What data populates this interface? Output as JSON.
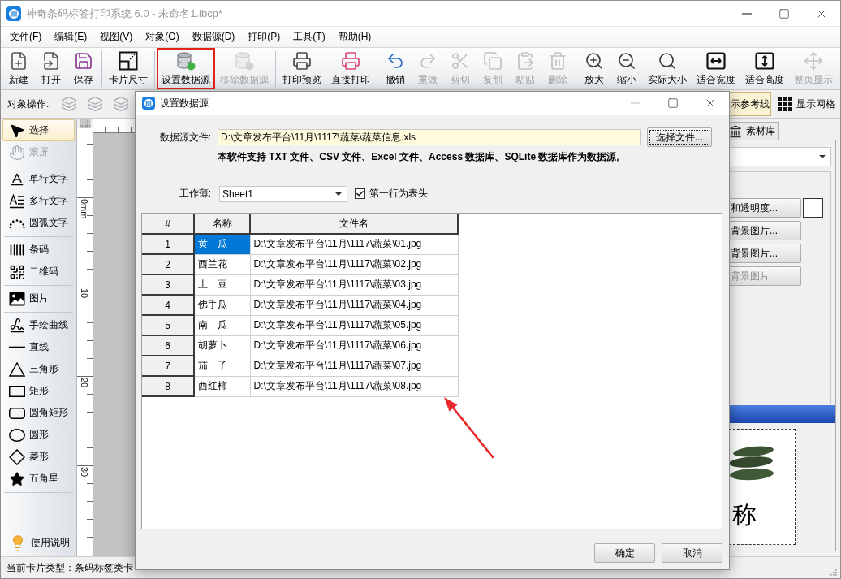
{
  "window": {
    "title": "神奇条码标签打印系统 6.0 - 未命名1.lbcp*",
    "controls": [
      {
        "kind": "minimize"
      },
      {
        "kind": "maximize"
      },
      {
        "kind": "close"
      }
    ]
  },
  "menu": [
    "文件(F)",
    "编辑(E)",
    "视图(V)",
    "对象(O)",
    "数据源(D)",
    "打印(P)",
    "工具(T)",
    "帮助(H)"
  ],
  "toolbar": [
    [
      {
        "label": "新建",
        "disabled": false,
        "highlighted": false
      },
      {
        "label": "打开",
        "disabled": false,
        "highlighted": false
      },
      {
        "label": "保存",
        "disabled": false,
        "highlighted": false
      }
    ],
    [
      {
        "label": "卡片尺寸",
        "disabled": false,
        "highlighted": false
      }
    ],
    [
      {
        "label": "设置数据源",
        "disabled": false,
        "highlighted": true
      },
      {
        "label": "移除数据源",
        "disabled": true,
        "highlighted": false
      }
    ],
    [
      {
        "label": "打印预览",
        "disabled": false,
        "highlighted": false
      },
      {
        "label": "直接打印",
        "disabled": false,
        "highlighted": false
      }
    ],
    [
      {
        "label": "撤销",
        "disabled": false,
        "highlighted": false
      },
      {
        "label": "重做",
        "disabled": true,
        "highlighted": false
      },
      {
        "label": "剪切",
        "disabled": true,
        "highlighted": false
      },
      {
        "label": "复制",
        "disabled": true,
        "highlighted": false
      },
      {
        "label": "粘贴",
        "disabled": true,
        "highlighted": false
      },
      {
        "label": "删除",
        "disabled": true,
        "highlighted": false
      }
    ],
    [
      {
        "label": "放大",
        "disabled": false,
        "highlighted": false
      },
      {
        "label": "缩小",
        "disabled": false,
        "highlighted": false
      },
      {
        "label": "实际大小",
        "disabled": false,
        "highlighted": false
      },
      {
        "label": "适合宽度",
        "disabled": false,
        "highlighted": false
      },
      {
        "label": "适合高度",
        "disabled": false,
        "highlighted": false
      },
      {
        "label": "整页显示",
        "disabled": true,
        "highlighted": false
      }
    ]
  ],
  "object_tools": {
    "label": "对象操作:",
    "buttons": [
      {
        "disabled": true
      },
      {
        "disabled": true
      },
      {
        "disabled": true
      }
    ]
  },
  "view_toggles": [
    {
      "label": "示参考线",
      "on": true
    },
    {
      "label": "显示网格",
      "on": false
    }
  ],
  "tools": [
    [
      {
        "label": "选择",
        "selected": true,
        "disabled": false
      },
      {
        "label": "滚屏",
        "selected": false,
        "disabled": true
      }
    ],
    [
      {
        "label": "单行文字",
        "selected": false,
        "disabled": false
      },
      {
        "label": "多行文字",
        "selected": false,
        "disabled": false
      },
      {
        "label": "圆弧文字",
        "selected": false,
        "disabled": false
      }
    ],
    [
      {
        "label": "条码",
        "selected": false,
        "disabled": false
      },
      {
        "label": "二维码",
        "selected": false,
        "disabled": false
      }
    ],
    [
      {
        "label": "图片",
        "selected": false,
        "disabled": false
      }
    ],
    [
      {
        "label": "手绘曲线",
        "selected": false,
        "disabled": false
      },
      {
        "label": "直线",
        "selected": false,
        "disabled": false
      },
      {
        "label": "三角形",
        "selected": false,
        "disabled": false
      },
      {
        "label": "矩形",
        "selected": false,
        "disabled": false
      },
      {
        "label": "圆角矩形",
        "selected": false,
        "disabled": false
      },
      {
        "label": "圆形",
        "selected": false,
        "disabled": false
      },
      {
        "label": "菱形",
        "selected": false,
        "disabled": false
      },
      {
        "label": "五角星",
        "selected": false,
        "disabled": false
      }
    ]
  ],
  "help": {
    "label": "使用说明"
  },
  "ruler": {
    "labels": [
      "0mm",
      "10",
      "20",
      "30"
    ]
  },
  "right_panel": {
    "tabs": [
      {
        "label": "素材库",
        "selected": false
      }
    ],
    "buttons": [
      {
        "label": "和透明度...",
        "disabled": false
      },
      {
        "label": "背景图片...",
        "disabled": false
      },
      {
        "label": "背景图片...",
        "disabled": false
      },
      {
        "label": "背景图片",
        "disabled": true
      }
    ],
    "preview_text": "称"
  },
  "status_bar": [
    "当前卡片类型：条码标签类卡"
  ],
  "dialog": {
    "title": "设置数据源",
    "controls": [
      {
        "kind": "minimize",
        "disabled": true
      },
      {
        "kind": "maximize",
        "disabled": false
      },
      {
        "kind": "close",
        "disabled": false
      }
    ],
    "file_label": "数据源文件:",
    "file_value": "D:\\文章发布平台\\11月\\1117\\蔬菜\\蔬菜信息.xls",
    "browse_button": {
      "label": "选择文件...",
      "focused": true
    },
    "note": "本软件支持 TXT 文件、CSV 文件、Excel 文件、Access 数据库、SQLite 数据库作为数据源。",
    "sheet_label": "工作薄:",
    "sheet_value": "Sheet1",
    "header_checkbox": {
      "label": "第一行为表头",
      "checked": true
    },
    "table": {
      "columns": [
        "#",
        "名称",
        "文件名"
      ],
      "rows": [
        {
          "cells": [
            "1",
            "黄　瓜",
            "D:\\文章发布平台\\11月\\1117\\蔬菜\\01.jpg"
          ],
          "selected": true
        },
        {
          "cells": [
            "2",
            "西兰花",
            "D:\\文章发布平台\\11月\\1117\\蔬菜\\02.jpg"
          ],
          "selected": false
        },
        {
          "cells": [
            "3",
            "土　豆",
            "D:\\文章发布平台\\11月\\1117\\蔬菜\\03.jpg"
          ],
          "selected": false
        },
        {
          "cells": [
            "4",
            "佛手瓜",
            "D:\\文章发布平台\\11月\\1117\\蔬菜\\04.jpg"
          ],
          "selected": false
        },
        {
          "cells": [
            "5",
            "南　瓜",
            "D:\\文章发布平台\\11月\\1117\\蔬菜\\05.jpg"
          ],
          "selected": false
        },
        {
          "cells": [
            "6",
            "胡萝卜",
            "D:\\文章发布平台\\11月\\1117\\蔬菜\\06.jpg"
          ],
          "selected": false
        },
        {
          "cells": [
            "7",
            "茄　子",
            "D:\\文章发布平台\\11月\\1117\\蔬菜\\07.jpg"
          ],
          "selected": false
        },
        {
          "cells": [
            "8",
            "西红柿",
            "D:\\文章发布平台\\11月\\1117\\蔬菜\\08.jpg"
          ],
          "selected": false
        }
      ]
    },
    "buttons": [
      "确定",
      "取消"
    ]
  }
}
